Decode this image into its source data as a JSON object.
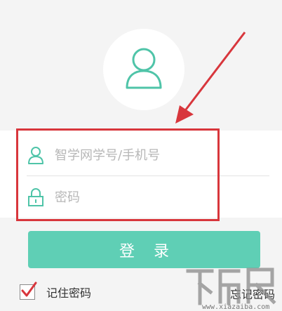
{
  "login": {
    "username_placeholder": "智学网学号/手机号",
    "password_placeholder": "密码",
    "login_button": "登 录",
    "remember_password": "记住密码",
    "remember_checked": true,
    "forgot_password": "忘记密码"
  },
  "watermark": {
    "url": "www.xiazaiba.com"
  },
  "colors": {
    "accent": "#5fcfb5",
    "icon": "#4fc4a8",
    "annotation": "#d8363c"
  }
}
